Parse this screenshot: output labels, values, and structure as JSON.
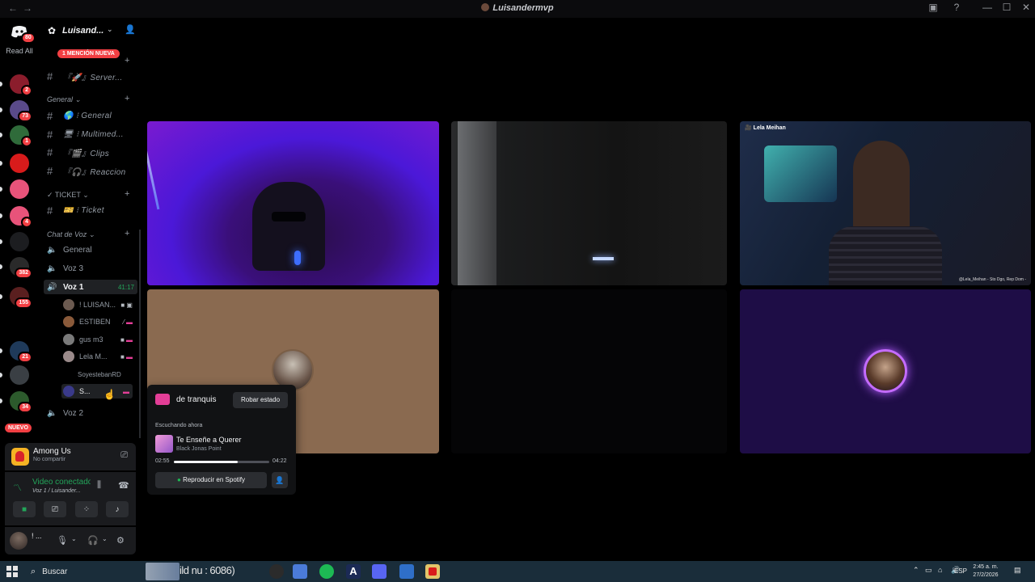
{
  "window": {
    "title": "Luisandermvp"
  },
  "rail": {
    "home_badge": "80",
    "read_all_label": "Read All",
    "servers": [
      {
        "badge": "2",
        "color": "#8b1d2c"
      },
      {
        "badge": "73",
        "color": "#5a4a8a"
      },
      {
        "badge": "1",
        "color": "#2f6b3a"
      },
      {
        "badge": "",
        "color": "#d81b1b"
      },
      {
        "badge": "",
        "color": "#e8537a"
      },
      {
        "badge": "4",
        "color": "#e8537a"
      },
      {
        "badge": "",
        "color": "#1c1d20"
      },
      {
        "badge": "382",
        "color": "#2a2a2a"
      },
      {
        "badge": "155",
        "color": "#5a1f1f"
      },
      {
        "badge": "21",
        "color": "#1f3a5a"
      },
      {
        "badge": "",
        "color": "#3a3f44"
      },
      {
        "badge": "34",
        "color": "#2c5a2c"
      }
    ],
    "new_label": "NUEVO"
  },
  "sidebar": {
    "server_name": "Luisand...",
    "mention_banner": "1 MENCIÓN NUEVA",
    "channels_top": [
      {
        "label": "『🚀』Server..."
      }
    ],
    "category_general": "General",
    "general_channels": [
      {
        "label": "🌎 ⁝ General"
      },
      {
        "label": "🖥 ⁝ Multimed..."
      },
      {
        "label": "『🎬』Clips"
      },
      {
        "label": "『🎧』Reaccion"
      }
    ],
    "category_ticket": "TICKET",
    "ticket_channels": [
      {
        "label": "🎫 ⁝ Ticket"
      }
    ],
    "category_voice": "Chat de Voz",
    "voice_channels": [
      {
        "label": "General"
      },
      {
        "label": "Voz 3"
      }
    ],
    "active_voice": {
      "label": "Voz 1",
      "timer": "41:17"
    },
    "voice_users": [
      {
        "name": "! LUISAN...",
        "avatar": "#6b5a50"
      },
      {
        "name": "ESTIBEN",
        "avatar": "#8a5a3a"
      },
      {
        "name": "gus m3",
        "avatar": "#7a7a7a"
      },
      {
        "name": "Lela M...",
        "avatar": "#9a8a8a"
      },
      {
        "name": "SoyestebanRD",
        "avatar": ""
      },
      {
        "name": "S...",
        "avatar": "#3a3a8a"
      }
    ],
    "voice_after": {
      "label": "Voz 2"
    }
  },
  "activity": {
    "title": "Among Us",
    "subtitle": "No compartir"
  },
  "voice_panel": {
    "status": "Video conectado",
    "channel": "Voz 1 / Luisander..."
  },
  "user_panel": {
    "name": "! ..."
  },
  "tiles": {
    "lela_label": "Lela Meihan",
    "lela_caption": "@Lela_Meihan - Sto Dgo, Rep Dom -"
  },
  "popout": {
    "status_text": "de tranquis",
    "steal_button": "Robar estado",
    "listening_label": "Escuchando ahora",
    "song": "Te Enseñe a Querer",
    "artist": "Black Jonas Point",
    "elapsed": "02:55",
    "duration": "04:22",
    "progress": 0.67,
    "play_button": "Reproducir en Spotify"
  },
  "taskbar": {
    "search_placeholder": "Buscar",
    "overlay_text": "ild nu : 6086)",
    "lang": "ESP",
    "time": "2:45 a. m.",
    "date": "27/2/2026"
  },
  "colors": {
    "accent_green": "#23a55a",
    "mention_red": "#f23f43",
    "spotify_green": "#1db954"
  }
}
